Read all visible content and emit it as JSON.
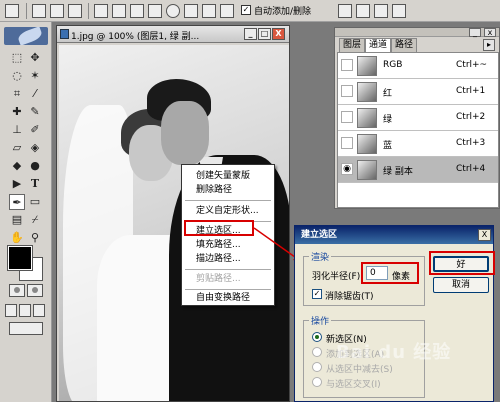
{
  "options_bar": {
    "auto_add_delete_label": "自动添加/删除",
    "auto_add_checked": "✓"
  },
  "document": {
    "title": "1.jpg @ 100% (图层1, 绿  副...",
    "minimize": "_",
    "maximize": "□",
    "close": "X"
  },
  "context_menu": {
    "items": [
      {
        "label": "创建矢量蒙版",
        "enabled": true
      },
      {
        "label": "删除路径",
        "enabled": true
      },
      {
        "label": "定义自定形状...",
        "enabled": true
      },
      {
        "label": "建立选区...",
        "enabled": true
      },
      {
        "label": "填充路径...",
        "enabled": true
      },
      {
        "label": "描边路径...",
        "enabled": true
      },
      {
        "label": "剪贴路径...",
        "enabled": false
      },
      {
        "label": "自由变换路径",
        "enabled": true
      }
    ]
  },
  "panel": {
    "tabs": [
      "图层",
      "通道",
      "路径"
    ],
    "active_tab": "通道",
    "channels": [
      {
        "name": "RGB",
        "shortcut": "Ctrl+~",
        "visible": false
      },
      {
        "name": "红",
        "shortcut": "Ctrl+1",
        "visible": false
      },
      {
        "name": "绿",
        "shortcut": "Ctrl+2",
        "visible": false
      },
      {
        "name": "蓝",
        "shortcut": "Ctrl+3",
        "visible": false
      },
      {
        "name": "绿 副本",
        "shortcut": "Ctrl+4",
        "visible": true
      }
    ]
  },
  "dialog": {
    "title": "建立选区",
    "close": "X",
    "render_group": "渲染",
    "feather_label": "羽化半径(F):",
    "feather_value": "0",
    "feather_unit": "像素",
    "antialias_label": "消除锯齿(T)",
    "antialias_check": "✓",
    "operation_group": "操作",
    "ops": [
      {
        "label": "新选区(N)",
        "enabled": true,
        "selected": true
      },
      {
        "label": "添加到选区(A)",
        "enabled": false,
        "selected": false
      },
      {
        "label": "从选区中减去(S)",
        "enabled": false,
        "selected": false
      },
      {
        "label": "与选区交叉(I)",
        "enabled": false,
        "selected": false
      }
    ],
    "ok_label": "好",
    "cancel_label": "取消"
  },
  "toolbox": {
    "text_tool_glyph": "T"
  },
  "watermark": "Bai du 经验",
  "colors": {
    "highlight": "#d80000",
    "dialog_title": "#0a246a",
    "selected_channel": "#b9b9b9"
  }
}
